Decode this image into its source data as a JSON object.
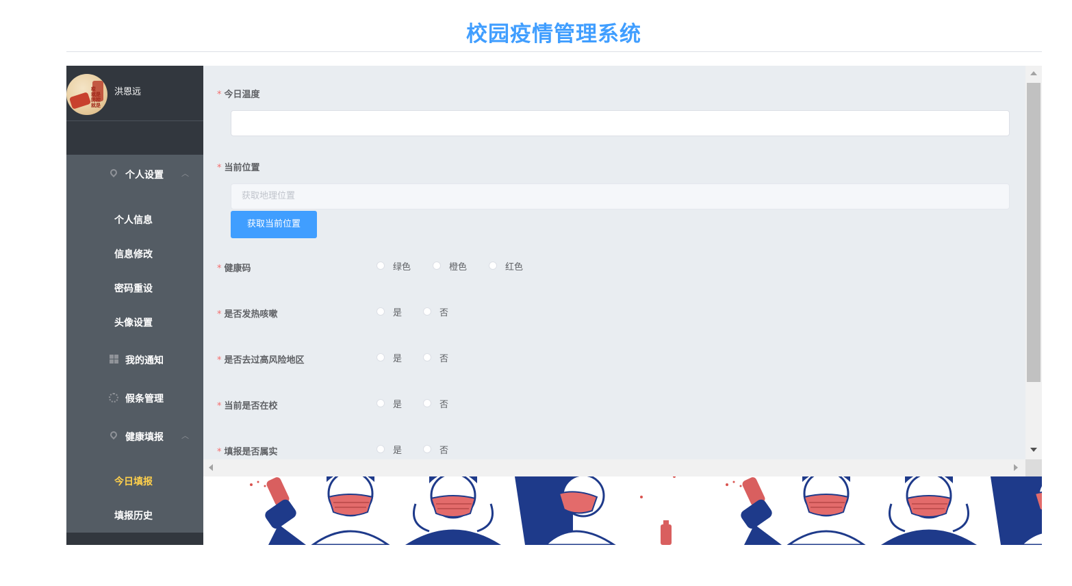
{
  "header": {
    "title": "校园疫情管理系统"
  },
  "user": {
    "name": "洪恩远",
    "avatar_text": "疫\n就是命\n防控\n就是"
  },
  "sidebar": {
    "groups": [
      {
        "label": "个人设置",
        "icon": "location-icon",
        "expanded": true,
        "items": [
          "个人信息",
          "信息修改",
          "密码重设",
          "头像设置"
        ]
      },
      {
        "label": "我的通知",
        "icon": "grid-icon"
      },
      {
        "label": "假条管理",
        "icon": "gear-icon"
      },
      {
        "label": "健康填报",
        "icon": "location-icon",
        "expanded": true,
        "items": [
          "今日填报",
          "填报历史"
        ],
        "active_item": "今日填报"
      }
    ]
  },
  "form": {
    "temperature": {
      "label": "今日温度",
      "value": ""
    },
    "location": {
      "label": "当前位置",
      "placeholder": "获取地理位置",
      "button": "获取当前位置"
    },
    "health_code": {
      "label": "健康码",
      "options": [
        "绿色",
        "橙色",
        "红色"
      ]
    },
    "fever": {
      "label": "是否发热咳嗽",
      "options": [
        "是",
        "否"
      ]
    },
    "high_risk": {
      "label": "是否去过高风险地区",
      "options": [
        "是",
        "否"
      ]
    },
    "on_campus": {
      "label": "当前是否在校",
      "options": [
        "是",
        "否"
      ]
    },
    "truthful": {
      "label": "填报是否属实",
      "options": [
        "是",
        "否"
      ]
    }
  },
  "colors": {
    "accent": "#409eff",
    "menu_bg": "#545c64",
    "active_menu": "#ffd04b",
    "required": "#f56c6c"
  }
}
